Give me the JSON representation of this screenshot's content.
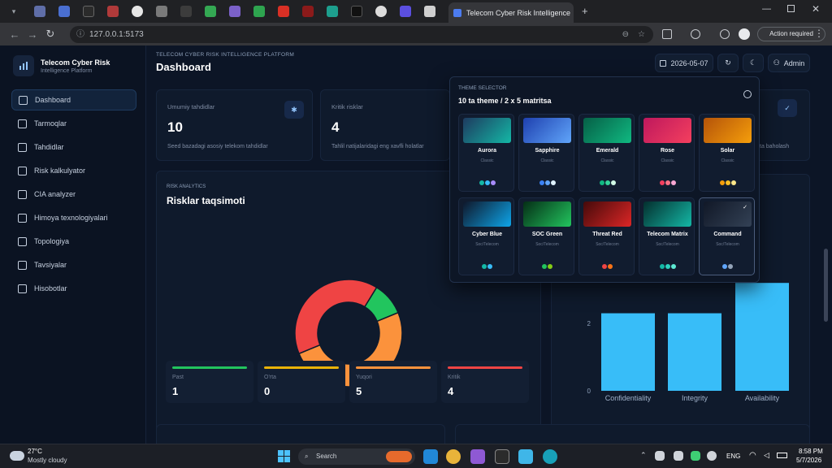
{
  "browser": {
    "active_tab_title": "Telecom Cyber Risk Intelligence",
    "url": "127.0.0.1:5173",
    "action_required": "Action required",
    "new_tab": "+",
    "window_controls": [
      "minimize-icon",
      "maximize-icon",
      "close-icon"
    ]
  },
  "app": {
    "brand_title": "Telecom Cyber Risk",
    "brand_subtitle": "Intelligence Platform",
    "eyebrow": "TELECOM CYBER RISK INTELLIGENCE PLATFORM",
    "page_title": "Dashboard",
    "date": "2026-05-07",
    "user": "Admin"
  },
  "sidebar": {
    "items": [
      {
        "label": "Dashboard",
        "icon": "grid-icon",
        "active": true
      },
      {
        "label": "Tarmoqlar",
        "icon": "network-icon"
      },
      {
        "label": "Tahdidlar",
        "icon": "bug-icon"
      },
      {
        "label": "Risk kalkulyator",
        "icon": "gauge-icon"
      },
      {
        "label": "CIA analyzer",
        "icon": "target-icon"
      },
      {
        "label": "Himoya texnologiyalari",
        "icon": "shield-icon"
      },
      {
        "label": "Topologiya",
        "icon": "topology-icon"
      },
      {
        "label": "Tavsiyalar",
        "icon": "bulb-icon"
      },
      {
        "label": "Hisobotlar",
        "icon": "report-icon"
      }
    ]
  },
  "kpis": [
    {
      "label": "Umumiy tahdidlar",
      "value": "10",
      "desc": "Seed bazadagi asosiy telekom tahdidlar"
    },
    {
      "label": "Kritik risklar",
      "value": "4",
      "desc": "Tahlil natijalaridagi eng xavfli holatlar"
    },
    {
      "desc": "ta baholash"
    }
  ],
  "risk_chart": {
    "eyebrow": "RISK ANALYTICS",
    "title": "Risklar taqsimoti"
  },
  "risk_stats": [
    {
      "label": "Past",
      "value": "1",
      "color": "#22c55e"
    },
    {
      "label": "O'rta",
      "value": "0",
      "color": "#eab308"
    },
    {
      "label": "Yuqori",
      "value": "5",
      "color": "#fb923c"
    },
    {
      "label": "Kritik",
      "value": "4",
      "color": "#ef4444"
    }
  ],
  "chart_data": [
    {
      "type": "pie",
      "title": "Risklar taqsimoti",
      "categories": [
        "Past",
        "O'rta",
        "Yuqori",
        "Kritik"
      ],
      "values": [
        1,
        0,
        5,
        4
      ],
      "colors": [
        "#22c55e",
        "#eab308",
        "#fb923c",
        "#ef4444"
      ]
    },
    {
      "type": "bar",
      "categories": [
        "Confidentiality",
        "Integrity",
        "Availability"
      ],
      "values": [
        2.3,
        2.3,
        3.2
      ],
      "ylim": [
        0,
        4
      ],
      "y_ticks": [
        "0",
        "2"
      ],
      "colors": [
        "#38bdf8"
      ]
    }
  ],
  "theme_selector": {
    "eyebrow": "THEME SELECTOR",
    "title": "10 ta theme / 2 x 5 matritsa",
    "themes": [
      {
        "name": "Aurora",
        "sub": "Classic",
        "g1": "#1e3a5f",
        "g2": "#14b8a6",
        "dots": [
          "#14b8a6",
          "#38bdf8",
          "#a78bfa"
        ]
      },
      {
        "name": "Sapphire",
        "sub": "Classic",
        "g1": "#1e40af",
        "g2": "#60a5fa",
        "dots": [
          "#3b82f6",
          "#60a5fa",
          "#e0f2fe"
        ]
      },
      {
        "name": "Emerald",
        "sub": "Classic",
        "g1": "#065f46",
        "g2": "#10b981",
        "dots": [
          "#10b981",
          "#34d399",
          "#d1fae5"
        ]
      },
      {
        "name": "Rose",
        "sub": "Classic",
        "g1": "#be185d",
        "g2": "#f43f5e",
        "dots": [
          "#f43f5e",
          "#fb7185",
          "#f9a8d4"
        ]
      },
      {
        "name": "Solar",
        "sub": "Classic",
        "g1": "#b45309",
        "g2": "#f59e0b",
        "dots": [
          "#f59e0b",
          "#fbbf24",
          "#fde68a"
        ]
      },
      {
        "name": "Cyber Blue",
        "sub": "Soc/Telecom",
        "g1": "#0f172a",
        "g2": "#0ea5e9",
        "dots": [
          "#14b8a6",
          "#38bdf8"
        ]
      },
      {
        "name": "SOC Green",
        "sub": "Soc/Telecom",
        "g1": "#052e16",
        "g2": "#22c55e",
        "dots": [
          "#22c55e",
          "#84cc16"
        ]
      },
      {
        "name": "Threat Red",
        "sub": "Soc/Telecom",
        "g1": "#450a0a",
        "g2": "#dc2626",
        "dots": [
          "#ef4444",
          "#f97316"
        ]
      },
      {
        "name": "Telecom Matrix",
        "sub": "Soc/Telecom",
        "g1": "#042f2e",
        "g2": "#14b8a6",
        "dots": [
          "#14b8a6",
          "#2dd4bf",
          "#5eead4"
        ]
      },
      {
        "name": "Command",
        "sub": "Soc/Telecom",
        "g1": "#111827",
        "g2": "#334155",
        "dots": [
          "#60a5fa",
          "#94a3b8"
        ],
        "selected": true
      }
    ]
  },
  "taskbar": {
    "weather_temp": "27°C",
    "weather_desc": "Mostly cloudy",
    "search": "Search",
    "lang": "ENG",
    "time": "8:58 PM",
    "date": "5/7/2026"
  }
}
